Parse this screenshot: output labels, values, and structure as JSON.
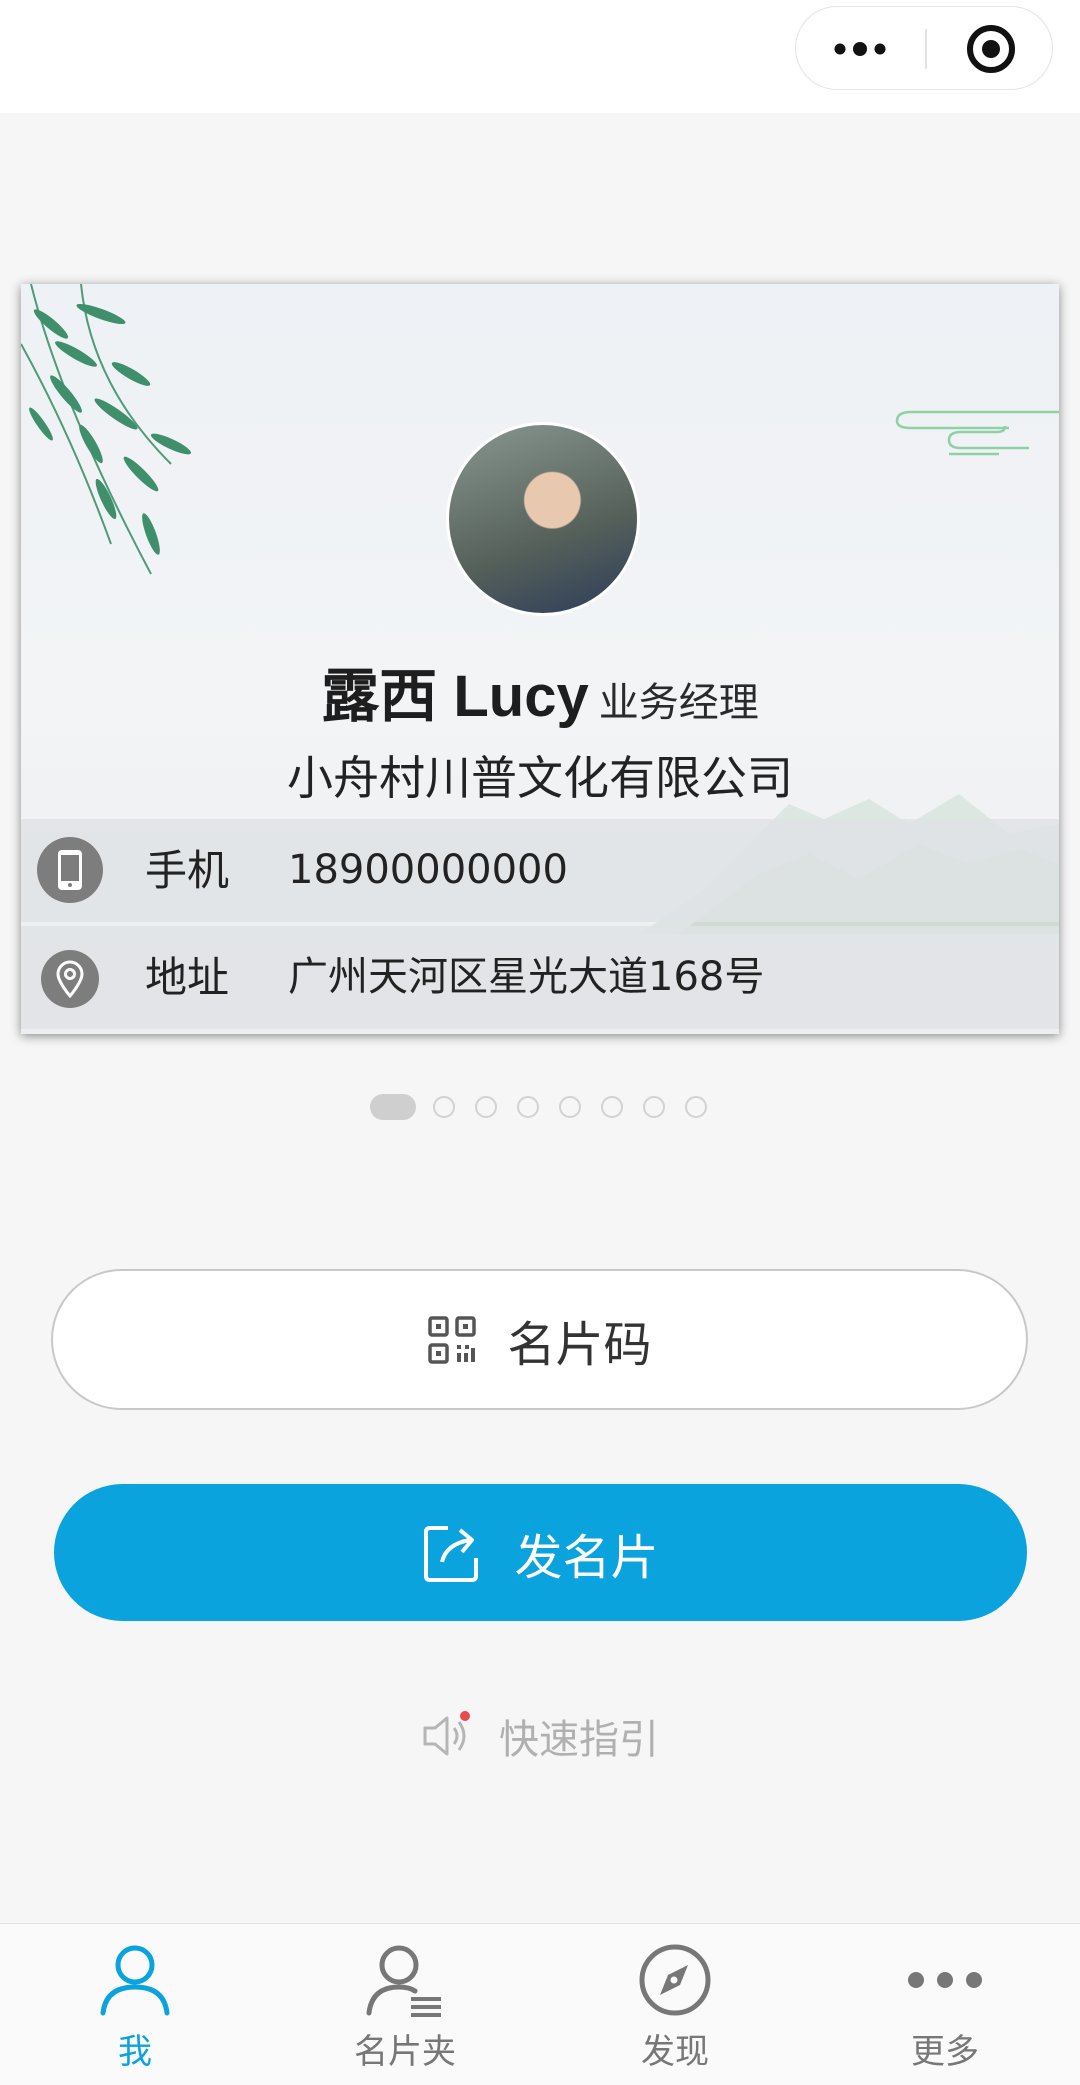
{
  "capsule": {
    "more_icon": "more-dots-icon",
    "close_icon": "target-close-icon"
  },
  "card": {
    "name": "露西 Lucy",
    "title": "业务经理",
    "company": "小舟村川普文化有限公司",
    "rows": [
      {
        "icon": "phone-icon",
        "label": "手机",
        "value": "18900000000"
      },
      {
        "icon": "location-pin-icon",
        "label": "地址",
        "value": "广州天河区星光大道168号"
      }
    ]
  },
  "carousel": {
    "total": 8,
    "active_index": 0
  },
  "buttons": {
    "code": {
      "label": "名片码",
      "icon": "qr-code-icon"
    },
    "send": {
      "label": "发名片",
      "icon": "share-icon"
    }
  },
  "guide": {
    "label": "快速指引",
    "icon": "speaker-icon"
  },
  "tabs": [
    {
      "label": "我",
      "icon": "person-icon",
      "active": true
    },
    {
      "label": "名片夹",
      "icon": "card-holder-icon",
      "active": false
    },
    {
      "label": "发现",
      "icon": "compass-icon",
      "active": false
    },
    {
      "label": "更多",
      "icon": "more-icon",
      "active": false
    }
  ],
  "colors": {
    "accent": "#0aa3dd",
    "background": "#f6f6f7",
    "icon_gray": "#7d7d7d"
  }
}
